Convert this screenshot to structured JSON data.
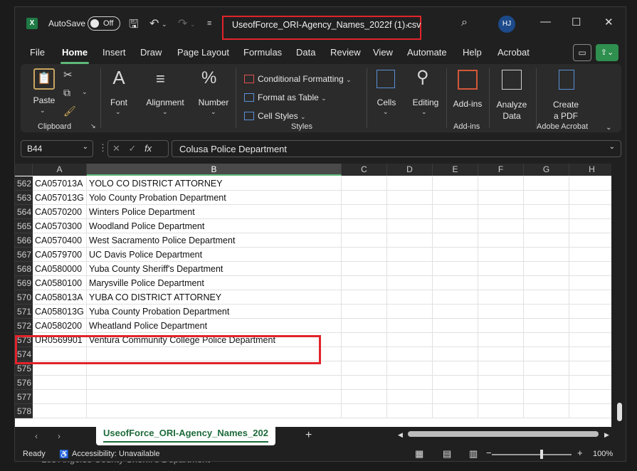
{
  "titlebar": {
    "autosave_label": "AutoSave",
    "autosave_state": "Off",
    "filename": "UseofForce_ORI-Agency_Names_2022f (1).csv",
    "user_initials": "HJ"
  },
  "menu": [
    "File",
    "Home",
    "Insert",
    "Draw",
    "Page Layout",
    "Formulas",
    "Data",
    "Review",
    "View",
    "Automate",
    "Help",
    "Acrobat"
  ],
  "ribbon": {
    "clipboard": {
      "paste": "Paste",
      "group": "Clipboard"
    },
    "font": "Font",
    "alignment": "Alignment",
    "number": "Number",
    "styles": {
      "cond_format": "Conditional Formatting",
      "format_table": "Format as Table",
      "cell_styles": "Cell Styles",
      "group": "Styles"
    },
    "cells": "Cells",
    "editing": "Editing",
    "addins": {
      "button": "Add-ins",
      "group": "Add-ins"
    },
    "analyze": {
      "line1": "Analyze",
      "line2": "Data"
    },
    "acrobat": {
      "line1": "Create",
      "line2": "a PDF",
      "group": "Adobe Acrobat"
    }
  },
  "formula_bar": {
    "cell_ref": "B44",
    "content": "Colusa Police Department"
  },
  "columns": [
    "A",
    "B",
    "C",
    "D",
    "E",
    "F",
    "G",
    "H"
  ],
  "rows": [
    {
      "num": "562",
      "a": "CA057013A",
      "b": "YOLO CO DISTRICT ATTORNEY"
    },
    {
      "num": "563",
      "a": "CA057013G",
      "b": "Yolo County Probation Department"
    },
    {
      "num": "564",
      "a": "CA0570200",
      "b": "Winters Police Department"
    },
    {
      "num": "565",
      "a": "CA0570300",
      "b": "Woodland Police Department"
    },
    {
      "num": "566",
      "a": "CA0570400",
      "b": "West Sacramento Police Department"
    },
    {
      "num": "567",
      "a": "CA0579700",
      "b": "UC Davis Police Department"
    },
    {
      "num": "568",
      "a": "CA0580000",
      "b": "Yuba County Sheriff's Department"
    },
    {
      "num": "569",
      "a": "CA0580100",
      "b": "Marysville Police Department"
    },
    {
      "num": "570",
      "a": "CA058013A",
      "b": "YUBA CO DISTRICT ATTORNEY"
    },
    {
      "num": "571",
      "a": "CA058013G",
      "b": "Yuba County Probation Department"
    },
    {
      "num": "572",
      "a": "CA0580200",
      "b": "Wheatland Police Department"
    },
    {
      "num": "573",
      "a": "UR0569901",
      "b": "Ventura Community College Police Department"
    },
    {
      "num": "574",
      "a": "",
      "b": ""
    },
    {
      "num": "575",
      "a": "",
      "b": ""
    },
    {
      "num": "576",
      "a": "",
      "b": ""
    },
    {
      "num": "577",
      "a": "",
      "b": ""
    },
    {
      "num": "578",
      "a": "",
      "b": ""
    }
  ],
  "sheet_tab": "UseofForce_ORI-Agency_Names_202",
  "status": {
    "ready": "Ready",
    "accessibility": "Accessibility: Unavailable",
    "zoom": "100%"
  },
  "background_text": "Los Angeles County Sheriff's Department"
}
